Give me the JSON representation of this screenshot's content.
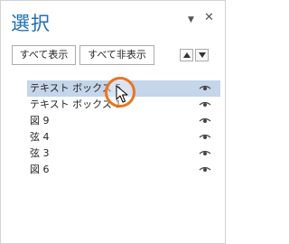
{
  "pane": {
    "title": "選択",
    "options_icon": "chevron-down-icon",
    "close_icon": "close-icon"
  },
  "toolbar": {
    "show_all_label": "すべて表示",
    "hide_all_label": "すべて非表示",
    "move_up_icon": "triangle-up-icon",
    "move_down_icon": "triangle-down-icon"
  },
  "items": [
    {
      "label": "テキスト ボックス 5",
      "selected": true,
      "visible": true
    },
    {
      "label": "テキスト ボックス 1",
      "selected": false,
      "visible": true
    },
    {
      "label": "図 9",
      "selected": false,
      "visible": true
    },
    {
      "label": "弦 4",
      "selected": false,
      "visible": true
    },
    {
      "label": "弦 3",
      "selected": false,
      "visible": true
    },
    {
      "label": "図 6",
      "selected": false,
      "visible": true
    }
  ],
  "colors": {
    "title": "#1e6fb5",
    "selected_row": "#c5d5ea",
    "highlight_ring": "#e8761e"
  }
}
